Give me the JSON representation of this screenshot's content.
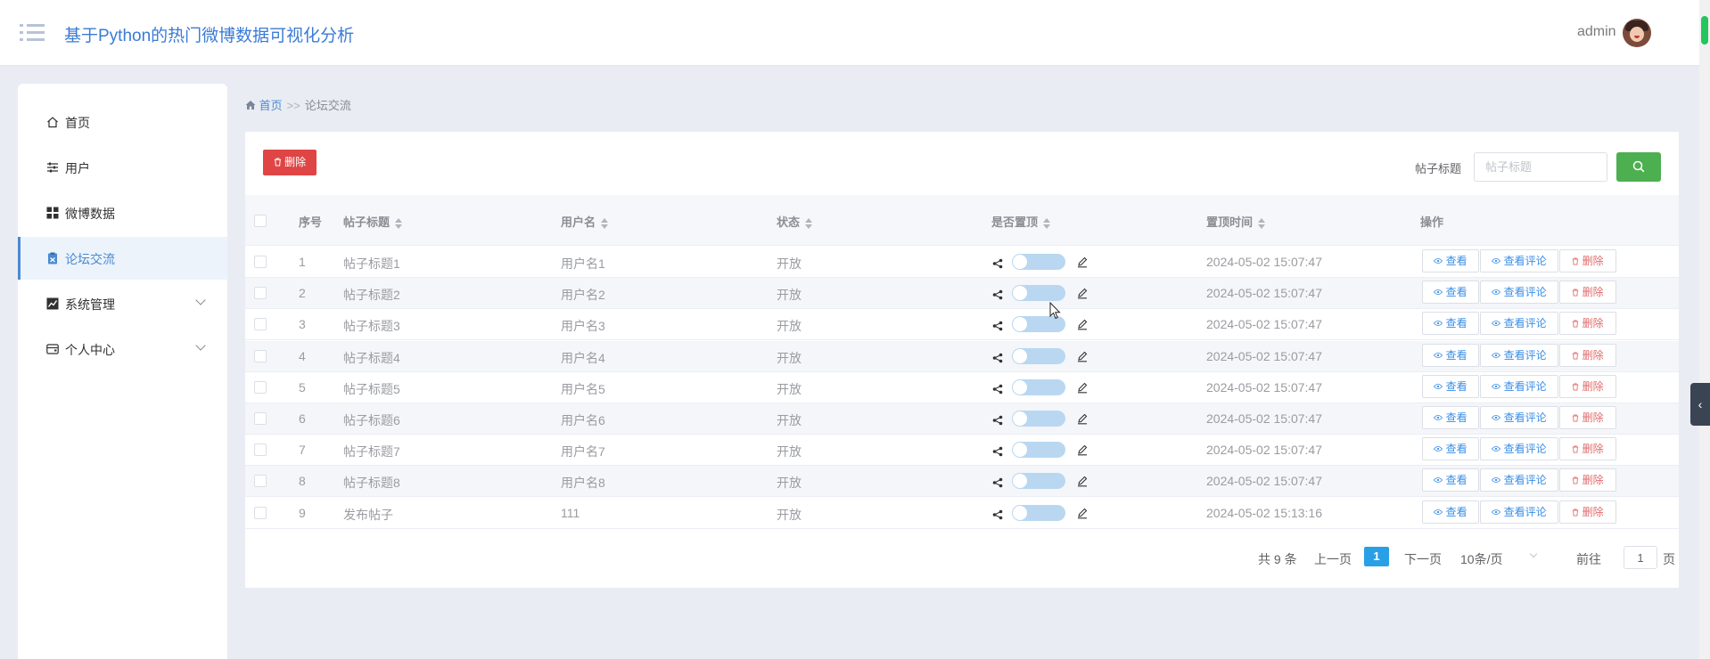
{
  "header": {
    "title": "基于Python的热门微博数据可视化分析",
    "user": "admin"
  },
  "sidebar": {
    "items": [
      {
        "label": "首页",
        "icon": "home-icon",
        "active": false,
        "expandable": false
      },
      {
        "label": "用户",
        "icon": "sliders-icon",
        "active": false,
        "expandable": false
      },
      {
        "label": "微博数据",
        "icon": "grid-icon",
        "active": false,
        "expandable": false
      },
      {
        "label": "论坛交流",
        "icon": "clipboard-icon",
        "active": true,
        "expandable": false
      },
      {
        "label": "系统管理",
        "icon": "chart-line-icon",
        "active": false,
        "expandable": true
      },
      {
        "label": "个人中心",
        "icon": "wallet-icon",
        "active": false,
        "expandable": true
      }
    ]
  },
  "breadcrumb": {
    "home": "首页",
    "separator": ">>",
    "current": "论坛交流"
  },
  "toolbar": {
    "delete_label": "删除",
    "search_label": "帖子标题",
    "search_placeholder": "帖子标题",
    "search_value": ""
  },
  "table": {
    "columns": [
      "序号",
      "帖子标题",
      "用户名",
      "状态",
      "是否置顶",
      "置顶时间",
      "操作"
    ],
    "rows": [
      {
        "index": "1",
        "title": "帖子标题1",
        "username": "用户名1",
        "status": "开放",
        "pinned": false,
        "pinned_time": "2024-05-02 15:07:47"
      },
      {
        "index": "2",
        "title": "帖子标题2",
        "username": "用户名2",
        "status": "开放",
        "pinned": false,
        "pinned_time": "2024-05-02 15:07:47"
      },
      {
        "index": "3",
        "title": "帖子标题3",
        "username": "用户名3",
        "status": "开放",
        "pinned": false,
        "pinned_time": "2024-05-02 15:07:47"
      },
      {
        "index": "4",
        "title": "帖子标题4",
        "username": "用户名4",
        "status": "开放",
        "pinned": false,
        "pinned_time": "2024-05-02 15:07:47"
      },
      {
        "index": "5",
        "title": "帖子标题5",
        "username": "用户名5",
        "status": "开放",
        "pinned": false,
        "pinned_time": "2024-05-02 15:07:47"
      },
      {
        "index": "6",
        "title": "帖子标题6",
        "username": "用户名6",
        "status": "开放",
        "pinned": false,
        "pinned_time": "2024-05-02 15:07:47"
      },
      {
        "index": "7",
        "title": "帖子标题7",
        "username": "用户名7",
        "status": "开放",
        "pinned": false,
        "pinned_time": "2024-05-02 15:07:47"
      },
      {
        "index": "8",
        "title": "帖子标题8",
        "username": "用户名8",
        "status": "开放",
        "pinned": false,
        "pinned_time": "2024-05-02 15:07:47"
      },
      {
        "index": "9",
        "title": "发布帖子",
        "username": "111",
        "status": "开放",
        "pinned": false,
        "pinned_time": "2024-05-02 15:13:16"
      }
    ],
    "actions": {
      "view": "查看",
      "view_comments": "查看评论",
      "delete": "删除"
    }
  },
  "pagination": {
    "total": "共 9 条",
    "prev": "上一页",
    "current_page": "1",
    "next": "下一页",
    "page_size": "10条/页",
    "goto_label": "前往",
    "goto_value": "1",
    "page_unit": "页"
  },
  "colors": {
    "accent": "#3a8ee6",
    "danger": "#e04545",
    "search_button": "#4caf50",
    "active_page": "#29a0e6"
  }
}
